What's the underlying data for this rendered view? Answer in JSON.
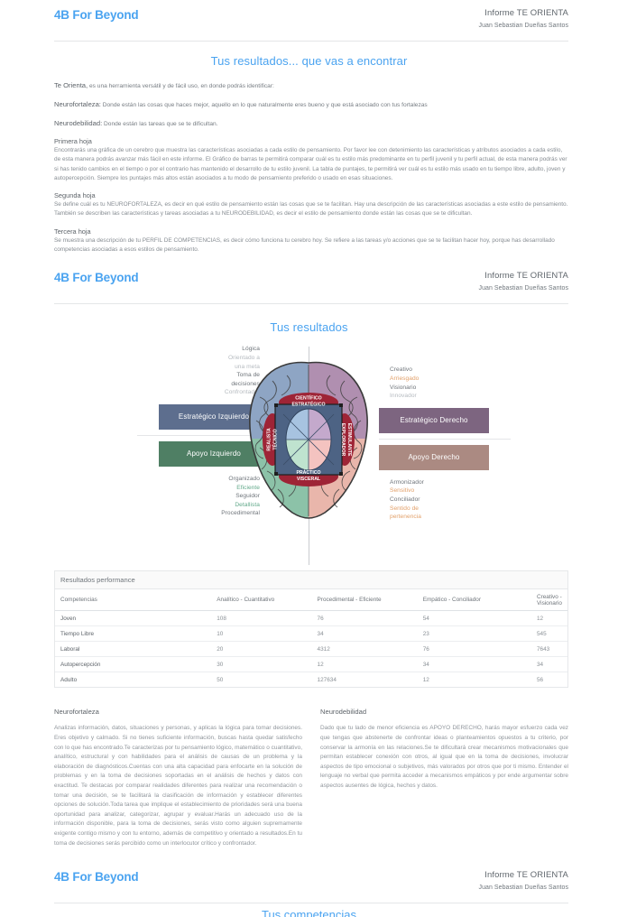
{
  "header": {
    "brand": "4B For Beyond",
    "report_title": "Informe TE ORIENTA",
    "user_name": "Juan Sebastian Dueñas Santos"
  },
  "page1": {
    "title": "Tus resultados... que vas a encontrar",
    "lead_bold": "Te Orienta,",
    "lead_rest": " es una herramienta versátil y de fácil uso, en donde podrás identificar:",
    "neurofortaleza_label": "Neurofortaleza:",
    "neurofortaleza_text": " Donde están las cosas que haces mejor, aquello en lo que naturalmente eres bueno y que está asociado con tus fortalezas",
    "neurodebilidad_label": "Neurodebilidad:",
    "neurodebilidad_text": " Donde están las tareas que se te dificultan.",
    "blocks": [
      {
        "heading": "Primera hoja",
        "body": "Encontrarás una gráfica de un cerebro que muestra las características asociadas a cada estilo de pensamiento. Por favor lee con detenimiento las características y atributos asociados a cada estilo, de esta manera podrás avanzar más fácil en este informe. El Gráfico de barras te permitirá comparar cuál es tu estilo más predominante en tu perfil juvenil y tu perfil actual, de esta manera podrás ver si has tenido cambios en el tiempo o por el contrario has mantenido el desarrollo de tu estilo juvenil. La tabla de puntajes, te permitirá ver cuál es tu estilo más usado en tu tiempo libre, adulto, joven y autopercepción. Siempre los puntajes más altos están asociados a tu modo de pensamiento preferido o usado en esas situaciones."
      },
      {
        "heading": "Segunda hoja",
        "body": "Se define cuál es tu NEUROFORTALEZA, es decir en qué estilo de pensamiento están las cosas que se te facilitan. Hay una descripción de las características asociadas a este estilo de pensamiento. También se describen las características y tareas asociadas a tu NEURODEBILIDAD, es decir el estilo de pensamiento donde están las cosas que se te dificultan."
      },
      {
        "heading": "Tercera hoja",
        "body": "Se muestra una descripción de tu PERFIL DE COMPETENCIAS, es decir cómo funciona tu cerebro hoy. Se refiere a las tareas y/o acciones que se te facilitan hacer hoy, porque has desarrollado competencias asociadas a esos estilos de pensamiento."
      }
    ]
  },
  "page2": {
    "title": "Tus resultados",
    "brain": {
      "quadrant_labels": {
        "top": "CIENTÍFICO ESTRATÉGICO",
        "left": "REALISTA TÉCNICO",
        "right": "EXPLORADOR ESTIMULANTE",
        "bottom": "PRÁCTICO VISCERAL"
      },
      "colors": {
        "lobe_top_left": "#8ea5c4",
        "lobe_top_right": "#b08fb0",
        "lobe_bottom_left": "#8cc2a8",
        "lobe_bottom_right": "#e9b6ab",
        "pill_label": "#9e2436",
        "center_box": "#4d6384"
      },
      "left": {
        "top_traits": [
          {
            "text": "Lógica",
            "tone": "gray"
          },
          {
            "text": "Orientado a",
            "tone": "lgray"
          },
          {
            "text": "una meta",
            "tone": "lgray"
          },
          {
            "text": "Toma de",
            "tone": "gray"
          },
          {
            "text": "decisiones",
            "tone": "gray"
          },
          {
            "text": "Confrontador",
            "tone": "lgray"
          }
        ],
        "strategic_button": "Estratégico Izquierdo",
        "support_button": "Apoyo Izquierdo",
        "bottom_traits": [
          {
            "text": "Organizado",
            "tone": "gray"
          },
          {
            "text": "Eficiente",
            "tone": "green"
          },
          {
            "text": "Seguidor",
            "tone": "gray"
          },
          {
            "text": "Detallista",
            "tone": "green"
          },
          {
            "text": "Procedimental",
            "tone": "gray"
          }
        ]
      },
      "right": {
        "top_traits": [
          {
            "text": "Creativo",
            "tone": "gray"
          },
          {
            "text": "Arriesgado",
            "tone": "orange"
          },
          {
            "text": "Visionario",
            "tone": "gray"
          },
          {
            "text": "Innovador",
            "tone": "lgray"
          }
        ],
        "strategic_button": "Estratégico Derecho",
        "support_button": "Apoyo Derecho",
        "bottom_traits": [
          {
            "text": "Armonizador",
            "tone": "gray"
          },
          {
            "text": "Sensitivo",
            "tone": "orange"
          },
          {
            "text": "Conciliador",
            "tone": "gray"
          },
          {
            "text": "Sentido de",
            "tone": "orange"
          },
          {
            "text": "pertenencia",
            "tone": "orange"
          }
        ]
      }
    },
    "table": {
      "caption": "Resultados performance",
      "columns": [
        "Competencias",
        "Analítico - Cuantitativo",
        "Procedimental - Eficiente",
        "Empático - Conciliador",
        "Creativo - Visionario"
      ],
      "rows": [
        {
          "label": "Joven",
          "values": [
            "108",
            "76",
            "54",
            "12"
          ]
        },
        {
          "label": "Tiempo Libre",
          "values": [
            "10",
            "34",
            "23",
            "545"
          ]
        },
        {
          "label": "Laboral",
          "values": [
            "20",
            "4312",
            "76",
            "7643"
          ]
        },
        {
          "label": "Autopercepción",
          "values": [
            "30",
            "12",
            "34",
            "34"
          ]
        },
        {
          "label": "Adulto",
          "values": [
            "50",
            "127634",
            "12",
            "56"
          ]
        }
      ]
    },
    "narrative": {
      "left_heading": "Neurofortaleza",
      "left_body": "Analizas información, datos, situaciones y personas, y aplicas la lógica para tomar decisiones. Eres objetivo y calmado. Si no tienes suficiente información, buscas hasta quedar satisfecho con lo que has encontrado.Te caracterizas por tu pensamiento lógico, matemático o cuantitativo, analítico, estructural y con habilidades para el análisis de causas de un problema y la elaboración de diagnósticos.Cuentas con una alta capacidad para enfocarte en la solución de problemas y en la toma de decisiones soportadas en el análisis de hechos y datos con exactitud. Te destacas por comparar realidades diferentes para realizar una recomendación o tomar una decisión, se te facilitará la clasificación de información y establecer diferentes opciones de solución.Toda tarea que implique el establecimiento de prioridades será una buena oportunidad para analizar, categorizar, agrupar y evaluar.Harás un adecuado uso de la información disponible, para la toma de decisiones, serás visto como alguien supremamente exigente contigo mismo y con tu entorno, además de competitivo y orientado a resultados.En tu toma de decisiones serás percibido como un interlocutor crítico y confrontador.",
      "right_heading": "Neurodebilidad",
      "right_body": "Dado que tu lado de menor eficiencia es APOYO DERECHO, harás mayor esfuerzo cada vez que tengas que abstenerte de confrontar ideas o planteamientos opuestos a tu criterio, por conservar la armonía en las relaciones.Se te dificultará crear mecanismos motivacionales que permitan establecer conexión con otros, al igual que en la toma de decisiones, involucrar aspectos de tipo emocional o subjetivos, más valorados por otros que por ti mismo. Entender el lenguaje no verbal que permita acceder a mecanismos empáticos y por ende argumentar sobre aspectos ausentes de lógica, hechos y datos."
    }
  },
  "page3_peek": {
    "title": "Tus competencias"
  }
}
